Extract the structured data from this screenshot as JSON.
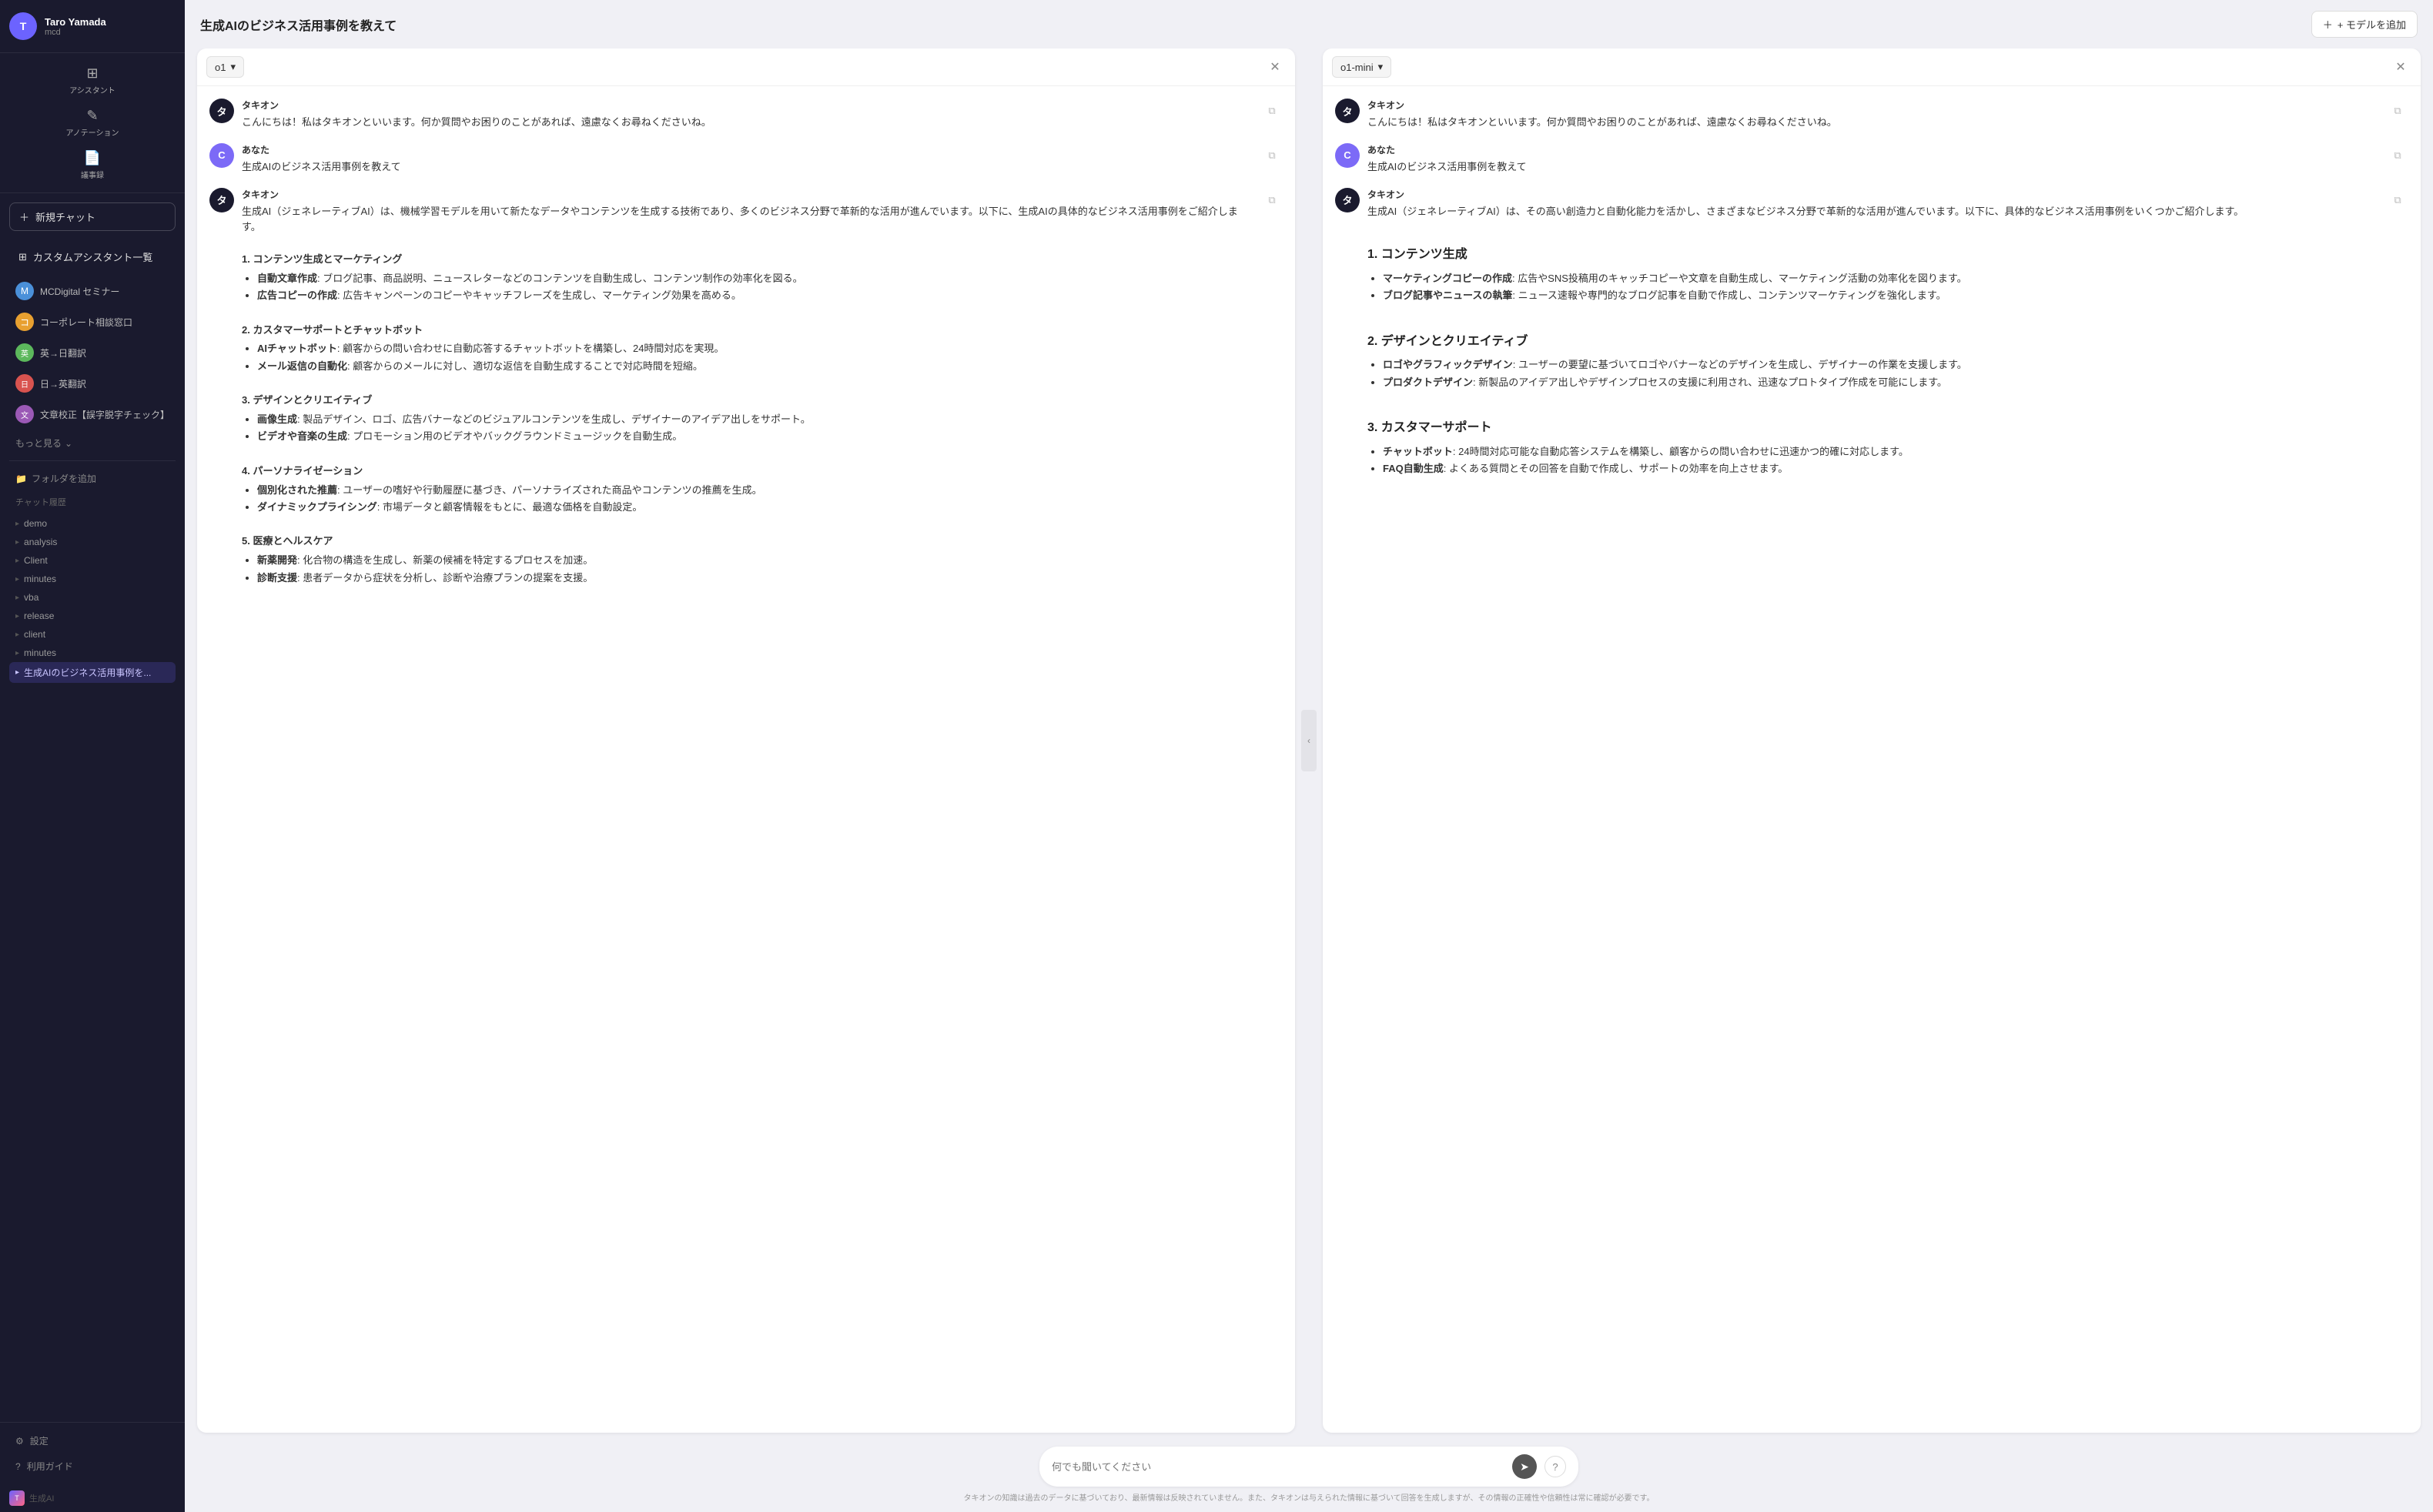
{
  "user": {
    "name": "Taro Yamada",
    "role": "mcd",
    "initials": "T"
  },
  "sidebar": {
    "new_chat_label": "新規チャット",
    "custom_assistant_label": "カスタムアシスタント一覧",
    "more_label": "もっと見る",
    "folder_label": "フォルダを追加",
    "chat_history_label": "チャット履歴",
    "add_model_label": "+ モデルを追加",
    "assistants": [
      {
        "name": "MCDigital セミナー",
        "color": "#4a90d9",
        "letter": "M"
      },
      {
        "name": "コーポレート相談窓口",
        "color": "#e8a030",
        "letter": "コ"
      },
      {
        "name": "英→日翻訳",
        "color": "#5cb85c",
        "letter": "英"
      },
      {
        "name": "日→英翻訳",
        "color": "#d9534f",
        "letter": "日"
      },
      {
        "name": "文章校正【誤字脱字チェック】",
        "color": "#9b59b6",
        "letter": "文"
      }
    ],
    "history_items": [
      {
        "label": "demo",
        "active": false
      },
      {
        "label": "analysis",
        "active": false
      },
      {
        "label": "Client",
        "active": false
      },
      {
        "label": "minutes",
        "active": false
      },
      {
        "label": "vba",
        "active": false
      },
      {
        "label": "release",
        "active": false
      },
      {
        "label": "client",
        "active": false
      },
      {
        "label": "minutes",
        "active": false
      },
      {
        "label": "生成AIのビジネス活用事例を...",
        "active": true
      }
    ],
    "bottom_items": [
      {
        "label": "設定",
        "icon": "⚙"
      },
      {
        "label": "利用ガイド",
        "icon": "?"
      }
    ],
    "brand": "生成AI"
  },
  "header": {
    "title": "生成AIのビジネス活用事例を教えて"
  },
  "panels": [
    {
      "id": "panel-1",
      "model": "o1",
      "messages": [
        {
          "sender": "タキオン",
          "role": "ai",
          "initials": "タ",
          "text_html": "こんにちは！私はタキオンといいます。何か質問やお困りのことがあれば、遠慮なくお尋ねくださいね。"
        },
        {
          "sender": "あなた",
          "role": "user",
          "initials": "C",
          "text_html": "生成AIのビジネス活用事例を教えて"
        },
        {
          "sender": "タキオン",
          "role": "ai",
          "initials": "タ",
          "text_html": "生成AI（ジェネレーティブAI）は、機械学習モデルを用いて新たなデータやコンテンツを生成する技術であり、多くのビジネス分野で革新的な活用が進んでいます。以下に、生成AIの具体的なビジネス活用事例をご紹介します。<br><br><strong>1. コンテンツ生成とマーケティング</strong><ul><li><span class='bold'>自動文章作成</span>: ブログ記事、商品説明、ニュースレターなどのコンテンツを自動生成し、コンテンツ制作の効率化を図る。</li><li><span class='bold'>広告コピーの作成</span>: 広告キャンペーンのコピーやキャッチフレーズを生成し、マーケティング効果を高める。</li></ul><br><strong>2. カスタマーサポートとチャットボット</strong><ul><li><span class='bold'>AIチャットボット</span>: 顧客からの問い合わせに自動応答するチャットボットを構築し、24時間対応を実現。</li><li><span class='bold'>メール返信の自動化</span>: 顧客からのメールに対し、適切な返信を自動生成することで対応時間を短縮。</li></ul><br><strong>3. デザインとクリエイティブ</strong><ul><li><span class='bold'>画像生成</span>: 製品デザイン、ロゴ、広告バナーなどのビジュアルコンテンツを生成し、デザイナーのアイデア出しをサポート。</li><li><span class='bold'>ビデオや音楽の生成</span>: プロモーション用のビデオやバックグラウンドミュージックを自動生成。</li></ul><br><strong>4. パーソナライゼーション</strong><ul><li><span class='bold'>個別化された推薦</span>: ユーザーの嗜好や行動履歴に基づき、パーソナライズされた商品やコンテンツの推薦を生成。</li><li><span class='bold'>ダイナミックプライシング</span>: 市場データと顧客情報をもとに、最適な価格を自動設定。</li></ul><br><strong>5. 医療とヘルスケア</strong><ul><li><span class='bold'>新薬開発</span>: 化合物の構造を生成し、新薬の候補を特定するプロセスを加速。</li><li><span class='bold'>診断支援</span>: 患者データから症状を分析し、診断や治療プランの提案を支援。</li></ul>"
        }
      ]
    },
    {
      "id": "panel-2",
      "model": "o1-mini",
      "messages": [
        {
          "sender": "タキオン",
          "role": "ai",
          "initials": "タ",
          "text_html": "こんにちは！私はタキオンといいます。何か質問やお困りのことがあれば、遠慮なくお尋ねくださいね。"
        },
        {
          "sender": "あなた",
          "role": "user",
          "initials": "C",
          "text_html": "生成AIのビジネス活用事例を教えて"
        },
        {
          "sender": "タキオン",
          "role": "ai",
          "initials": "タ",
          "text_html": "生成AI（ジェネレーティブAI）は、その高い創造力と自動化能力を活かし、さまざまなビジネス分野で革新的な活用が進んでいます。以下に、具体的なビジネス活用事例をいくつかご紹介します。<br><br><h1>1. コンテンツ生成</h1><ul><li><span class='bold'>マーケティングコピーの作成</span>: 広告やSNS投稿用のキャッチコピーや文章を自動生成し、マーケティング活動の効率化を図ります。</li><li><span class='bold'>ブログ記事やニュースの執筆</span>: ニュース速報や専門的なブログ記事を自動で作成し、コンテンツマーケティングを強化します。</li></ul><br><h1>2. デザインとクリエイティブ</h1><ul><li><span class='bold'>ロゴやグラフィックデザイン</span>: ユーザーの要望に基づいてロゴやバナーなどのデザインを生成し、デザイナーの作業を支援します。</li><li><span class='bold'>プロダクトデザイン</span>: 新製品のアイデア出しやデザインプロセスの支援に利用され、迅速なプロトタイプ作成を可能にします。</li></ul><br><h1>3. カスタマーサポート</h1><ul><li><span class='bold'>チャットボット</span>: 24時間対応可能な自動応答システムを構築し、顧客からの問い合わせに迅速かつ的確に対応します。</li><li><span class='bold'>FAQ自動生成</span>: よくある質問とその回答を自動で作成し、サポートの効率を向上させます。</li></ul>"
        }
      ]
    }
  ],
  "input": {
    "placeholder": "何でも聞いてください"
  },
  "footer": {
    "note": "タキオンの知識は過去のデータに基づいており、最新情報は反映されていません。また、タキオンは与えられた情報に基づいて回答を生成しますが、その情報の正確性や信頼性は常に確認が必要です。"
  }
}
